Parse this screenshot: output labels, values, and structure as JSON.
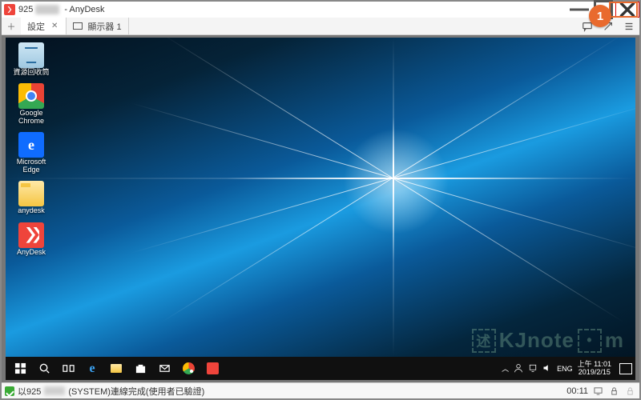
{
  "titlebar": {
    "id_prefix": "925",
    "app_name": "AnyDesk",
    "title_combined": "925███ - AnyDesk"
  },
  "annotation": {
    "step_number": "1"
  },
  "tabs": {
    "settings_label": "設定",
    "display_label": "顯示器 1"
  },
  "desktop_icons": [
    {
      "key": "recycle",
      "label": "資源回收筒"
    },
    {
      "key": "chrome",
      "label": "Google\nChrome"
    },
    {
      "key": "edge",
      "label": "Microsoft\nEdge"
    },
    {
      "key": "folder",
      "label": "anydesk"
    },
    {
      "key": "adesk",
      "label": "AnyDesk"
    }
  ],
  "remote_tray": {
    "ime": "ENG",
    "time": "上午 11:01",
    "date": "2019/2/15"
  },
  "watermark": {
    "text": "KJnote",
    "suffix": "m"
  },
  "status": {
    "prefix": "以925",
    "msg": "(SYSTEM)連線完成(使用者已驗證)",
    "elapsed": "00:11"
  }
}
